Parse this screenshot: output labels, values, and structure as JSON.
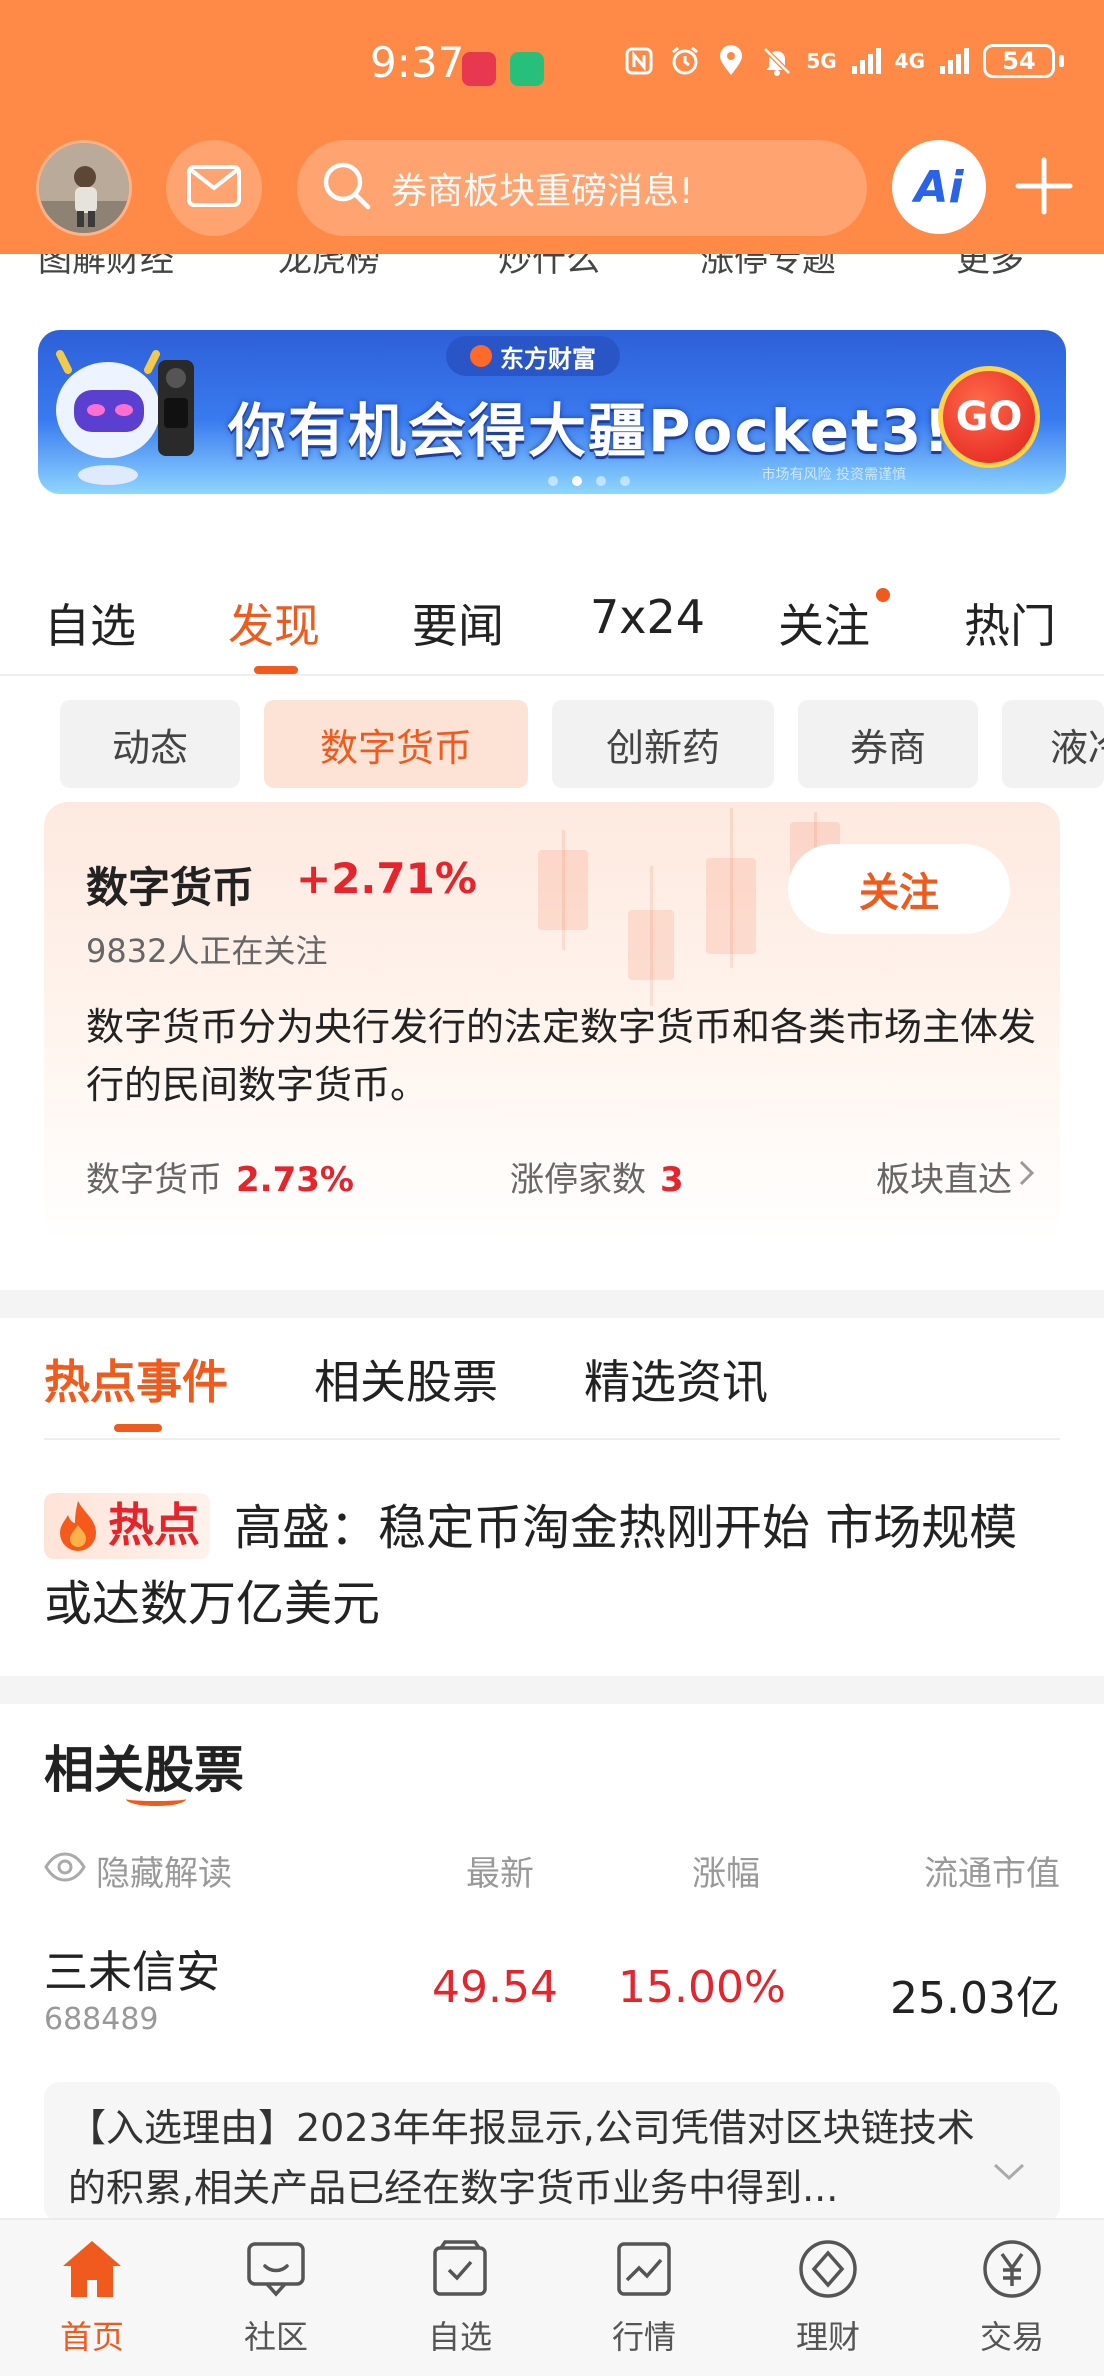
{
  "status_bar": {
    "time": "9:37",
    "network_1": "5G",
    "network_2": "4G",
    "battery": "54"
  },
  "header": {
    "search_placeholder": "券商板块重磅消息!",
    "ai_label": "Ai"
  },
  "shortcuts": [
    "图解财经",
    "龙虎榜",
    "炒什么",
    "涨停专题",
    "更多"
  ],
  "banner": {
    "brand": "东方财富",
    "title": "你有机会得大疆Pocket3!",
    "go_label": "GO",
    "note": "市场有风险 投资需谨慎"
  },
  "main_tabs": [
    "自选",
    "发现",
    "要闻",
    "7x24",
    "关注",
    "热门"
  ],
  "main_tab_active": "发现",
  "sector_chips": [
    "动态",
    "数字货币",
    "创新药",
    "券商",
    "液冷"
  ],
  "sector": {
    "name": "数字货币",
    "change": "+2.71%",
    "follow_label": "关注",
    "followers": "9832人正在关注",
    "description": "数字货币分为央行发行的法定数字货币和各类市场主体发行的民间数字货币。",
    "stat1_label": "数字货币",
    "stat1_value": "2.73%",
    "stat2_label": "涨停家数",
    "stat2_value": "3",
    "direct_label": "板块直达"
  },
  "content_tabs": [
    "热点事件",
    "相关股票",
    "精选资讯"
  ],
  "hot_news": {
    "badge": "热点",
    "headline": "高盛：稳定币淘金热刚开始 市场规模或达数万亿美元"
  },
  "related": {
    "title": "相关股票",
    "hide_label": "隐藏解读",
    "col_latest": "最新",
    "col_change": "涨幅",
    "col_mcap": "流通市值",
    "rows": [
      {
        "name": "三未信安",
        "code": "688489",
        "latest": "49.54",
        "change": "15.00%",
        "mcap": "25.03亿"
      }
    ],
    "reason": "【入选理由】2023年年报显示,公司凭借对区块链技术的积累,相关产品已经在数字货币业务中得到..."
  },
  "bottom_nav": [
    "首页",
    "社区",
    "自选",
    "行情",
    "理财",
    "交易"
  ],
  "colors": {
    "brand_orange": "#ff8a48",
    "accent": "#f05a1d",
    "up_red": "#e6242b"
  }
}
